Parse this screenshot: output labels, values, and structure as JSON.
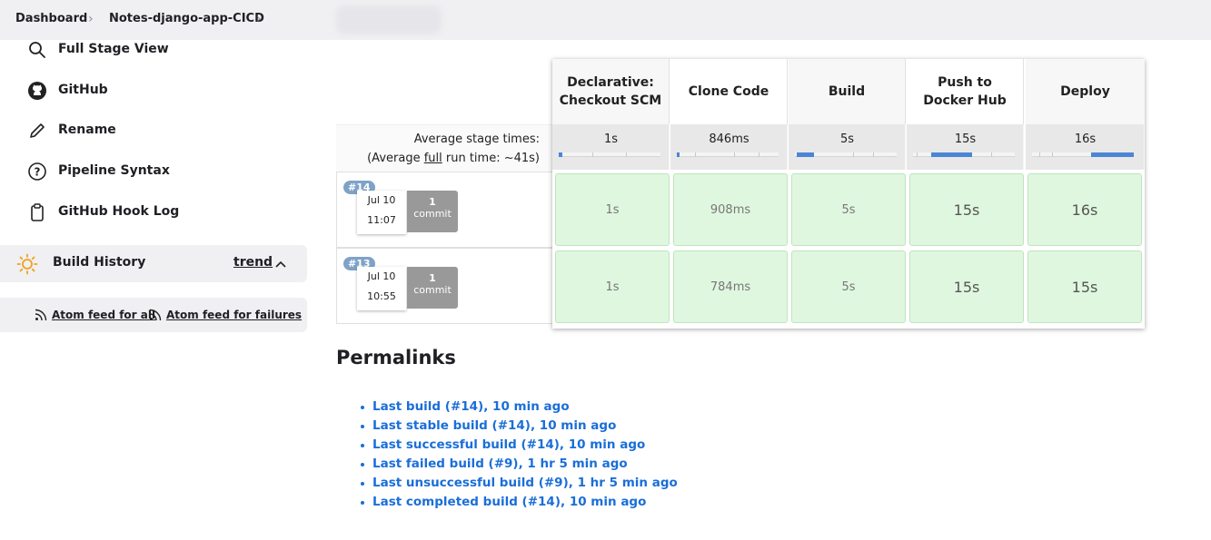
{
  "breadcrumb": {
    "items": [
      "Dashboard",
      "Notes-django-app-CICD"
    ]
  },
  "sidebar": {
    "items": [
      {
        "label": "Full Stage View",
        "icon": "search-icon"
      },
      {
        "label": "GitHub",
        "icon": "github-icon"
      },
      {
        "label": "Rename",
        "icon": "pencil-icon"
      },
      {
        "label": "Pipeline Syntax",
        "icon": "help-icon"
      },
      {
        "label": "GitHub Hook Log",
        "icon": "clipboard-icon"
      }
    ],
    "build_history": {
      "title": "Build History",
      "trend": "trend",
      "icon": "sun-icon"
    },
    "feeds": {
      "all": "Atom feed for all",
      "failures": "Atom feed for failures"
    }
  },
  "stage_view": {
    "avg_label": "Average stage times:",
    "avg_full_prefix": "(Average ",
    "avg_full_word": "full",
    "avg_full_suffix": " run time: ~41s)",
    "stages": [
      {
        "name": "Declarative: Checkout SCM",
        "avg": "1s"
      },
      {
        "name": "Clone Code",
        "avg": "846ms"
      },
      {
        "name": "Build",
        "avg": "5s"
      },
      {
        "name": "Push to Docker Hub",
        "avg": "15s"
      },
      {
        "name": "Deploy",
        "avg": "16s"
      }
    ],
    "runs": [
      {
        "id": "#14",
        "date": "Jul 10",
        "time": "11:07",
        "commits": "1",
        "commit_label": "commit",
        "times": [
          "1s",
          "908ms",
          "5s",
          "15s",
          "16s"
        ]
      },
      {
        "id": "#13",
        "date": "Jul 10",
        "time": "10:55",
        "commits": "1",
        "commit_label": "commit",
        "times": [
          "1s",
          "784ms",
          "5s",
          "15s",
          "15s"
        ]
      }
    ],
    "colors": {
      "success_cell": "#dff7df",
      "progress": "#4a86d6",
      "badge": "#7fa2c7"
    }
  },
  "permalinks": {
    "title": "Permalinks",
    "links": [
      "Last build (#14), 10 min ago",
      "Last stable build (#14), 10 min ago",
      "Last successful build (#14), 10 min ago",
      "Last failed build (#9), 1 hr 5 min ago",
      "Last unsuccessful build (#9), 1 hr 5 min ago",
      "Last completed build (#14), 10 min ago"
    ]
  }
}
